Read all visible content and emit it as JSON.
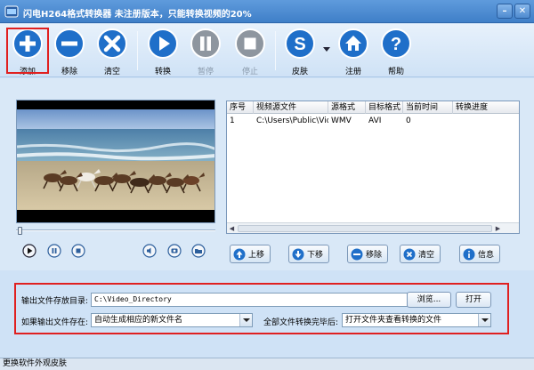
{
  "window": {
    "title": "闪电H264格式转换器    未注册版本，只能转换视频的20%"
  },
  "toolbar": {
    "add_label": "添加",
    "remove_label": "移除",
    "clear_label": "清空",
    "convert_label": "转换",
    "pause_label": "暂停",
    "stop_label": "停止",
    "skin_label": "皮肤",
    "register_label": "注册",
    "help_label": "帮助"
  },
  "table": {
    "headers": [
      "序号",
      "视频源文件",
      "源格式",
      "目标格式",
      "当前时间",
      "转换进度"
    ],
    "rows": [
      {
        "index": "1",
        "source": "C:\\Users\\Public\\Vide...",
        "src_format": "WMV",
        "dst_format": "AVI",
        "time": "0",
        "progress": ""
      }
    ]
  },
  "list_buttons": {
    "up": "上移",
    "down": "下移",
    "remove": "移除",
    "clear": "清空",
    "info": "信息"
  },
  "output": {
    "dir_label": "输出文件存放目录:",
    "dir_value": "C:\\Video_Directory",
    "browse_label": "浏览...",
    "open_label": "打开",
    "exists_label": "如果输出文件存在:",
    "exists_value": "自动生成相应的新文件名",
    "after_label": "全部文件转换完毕后:",
    "after_value": "打开文件夹查看转换的文件"
  },
  "status": {
    "text": "更换软件外观皮肤"
  },
  "colors": {
    "accent": "#1f6fc9",
    "highlight": "#e02020"
  }
}
